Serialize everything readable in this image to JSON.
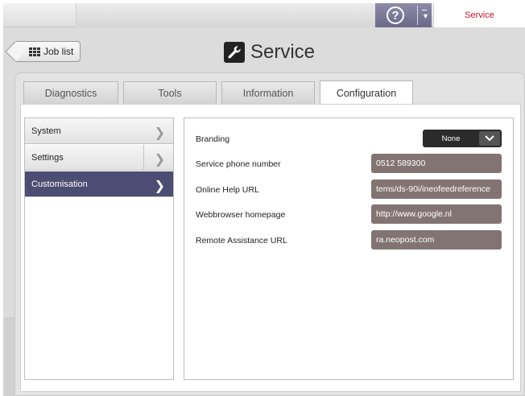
{
  "topbar": {
    "help_icon": "help-circle-icon",
    "help_glyph": "?",
    "service_label": "Service"
  },
  "header": {
    "back_label": "Job list",
    "title": "Service",
    "icon": "wrench-icon"
  },
  "tabs": [
    {
      "label": "Diagnostics",
      "active": false
    },
    {
      "label": "Tools",
      "active": false
    },
    {
      "label": "Information",
      "active": false
    },
    {
      "label": "Configuration",
      "active": true
    }
  ],
  "sidebar": {
    "items": [
      {
        "label": "System",
        "selected": false
      },
      {
        "label": "Settings",
        "selected": false
      },
      {
        "label": "Customisation",
        "selected": true
      }
    ]
  },
  "config": {
    "branding": {
      "label": "Branding",
      "value": "None"
    },
    "phone": {
      "label": "Service phone number",
      "value": "0512 589300"
    },
    "help_url": {
      "label": "Online Help URL",
      "value": "tems/ds-90i/ineofeedreference"
    },
    "homepage": {
      "label": "Webbrowser homepage",
      "value": "http://www.google.nl"
    },
    "remote": {
      "label": "Remote Assistance URL",
      "value": "ra.neopost.com"
    }
  },
  "colors": {
    "accent_selected": "#4d4c72",
    "field_bg": "#837474",
    "service_red": "#c8102e"
  }
}
